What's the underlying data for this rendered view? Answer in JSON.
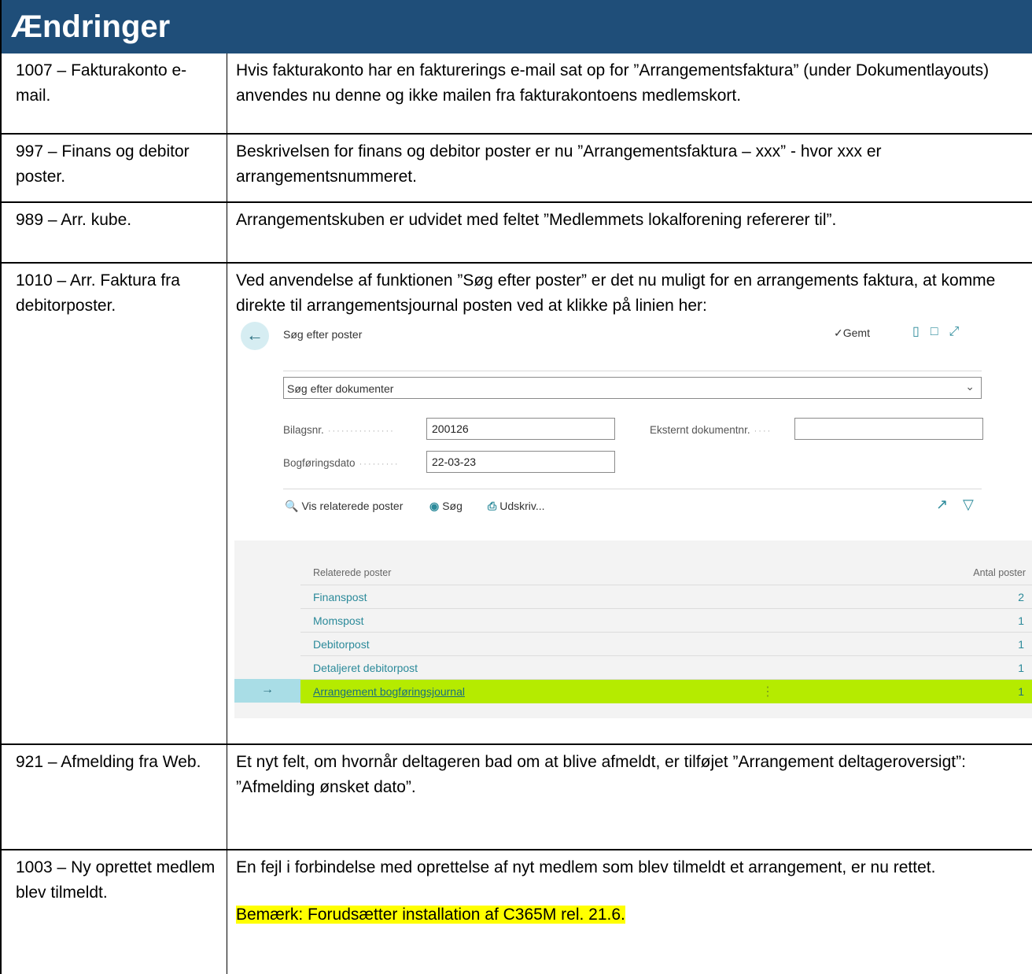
{
  "title": "Ændringer",
  "rows": [
    {
      "left": "1007 – Fakturakonto e-mail.",
      "right": "Hvis fakturakonto har en fakturerings e-mail sat op for ”Arrangementsfaktura” (under Dokumentlayouts) anvendes nu denne og ikke mailen fra fakturakontoens medlemskort."
    },
    {
      "left": "997 – Finans og debitor poster.",
      "right": "Beskrivelsen for finans og debitor poster er nu ”Arrangementsfaktura – xxx” - hvor xxx er arrangementsnummeret."
    },
    {
      "left": "989 – Arr. kube.",
      "right": "Arrangementskuben er udvidet med feltet ”Medlemmets lokalforening refererer til”."
    },
    {
      "left": "1010 – Arr. Faktura fra debitorposter.",
      "right": "Ved anvendelse af funktionen ”Søg efter poster” er det nu muligt for en arrangements faktura, at komme direkte til arrangementsjournal posten ved at klikke på linien her:"
    },
    {
      "left": "921 – Afmelding fra Web.",
      "right_line1": "Et nyt felt, om hvornår deltageren bad om at blive afmeldt, er tilføjet ”Arrangement deltageroversigt”:",
      "right_line2": "”Afmelding ønsket dato”."
    },
    {
      "left": "1003 – Ny oprettet medlem blev tilmeldt.",
      "right": "En fejl i forbindelse med oprettelse af nyt medlem som blev tilmeldt et arrangement, er nu rettet.",
      "note": "Bemærk: Forudsætter installation af C365M rel. 21.6."
    }
  ],
  "screenshot": {
    "page_title": "Søg efter poster",
    "saved_label": "Gemt",
    "search_select": "Søg efter dokumenter",
    "fields": [
      {
        "label": "Bilagsnr.",
        "value": "200126"
      },
      {
        "label": "Eksternt dokumentnr.",
        "value": ""
      },
      {
        "label": "Bogføringsdato",
        "value": "22-03-23"
      }
    ],
    "actions": [
      "Vis relaterede poster",
      "Søg",
      "Udskriv..."
    ],
    "table": {
      "columns": [
        "Relaterede poster",
        "Antal poster"
      ],
      "rows": [
        {
          "name": "Finanspost",
          "count": "2"
        },
        {
          "name": "Momspost",
          "count": "1"
        },
        {
          "name": "Debitorpost",
          "count": "1"
        },
        {
          "name": "Detaljeret debitorpost",
          "count": "1"
        },
        {
          "name": "Arrangement bogføringsjournal",
          "count": "1",
          "selected": true
        }
      ]
    }
  },
  "colors": {
    "title_bar": "#1f4e79",
    "accent": "#2b8a9a",
    "selected_row": "#b5eb00",
    "highlight": "#ffff00"
  }
}
